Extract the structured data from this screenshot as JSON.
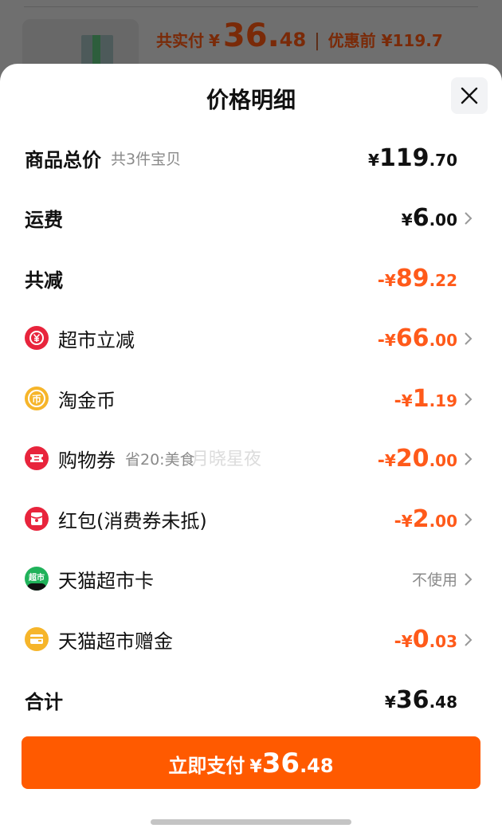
{
  "background": {
    "total_label": "共实付",
    "total_currency": "¥",
    "total_int": "36.",
    "total_dec": "48",
    "separator": "|",
    "before_label": "优惠前 ¥119.7"
  },
  "sheet": {
    "title": "价格明细",
    "close_icon": "close-icon"
  },
  "rows": {
    "goods": {
      "label": "商品总价",
      "sub": "共3件宝贝",
      "currency": "¥",
      "int": "119",
      "dec": ".70"
    },
    "shipping": {
      "label": "运费",
      "currency": "¥",
      "int": "6",
      "dec": ".00"
    },
    "discount_total": {
      "label": "共减",
      "sign": "-",
      "currency": "¥",
      "int": "89",
      "dec": ".22"
    },
    "supermarket_cut": {
      "label": "超市立减",
      "sign": "-",
      "currency": "¥",
      "int": "66",
      "dec": ".00",
      "icon": "yuan-coin-icon"
    },
    "taojin_coin": {
      "label": "淘金币",
      "sign": "-",
      "currency": "¥",
      "int": "1",
      "dec": ".19",
      "icon": "coin-icon",
      "icon_glyph": "币"
    },
    "shopping_voucher": {
      "label": "购物券",
      "sub": "省20:美食",
      "sign": "-",
      "currency": "¥",
      "int": "20",
      "dec": ".00",
      "icon": "ticket-icon"
    },
    "red_packet": {
      "label": "红包(消费券未抵)",
      "sign": "-",
      "currency": "¥",
      "int": "2",
      "dec": ".00",
      "icon": "red-packet-icon"
    },
    "tmall_card": {
      "label": "天猫超市卡",
      "value": "不使用",
      "icon": "tmall-card-icon",
      "icon_glyph": "超市"
    },
    "tmall_gift": {
      "label": "天猫超市赠金",
      "sign": "-",
      "currency": "¥",
      "int": "0",
      "dec": ".03",
      "icon": "wallet-icon"
    },
    "sum": {
      "label": "合计",
      "currency": "¥",
      "int": "36",
      "dec": ".48"
    }
  },
  "watermark": "月晓星夜",
  "pay_button": {
    "label": "立即支付",
    "currency": "¥",
    "int": "36",
    "dec": ".48"
  },
  "colors": {
    "accent": "#ff5a00",
    "discount": "#ff5a1a",
    "muted": "#8a8a8a"
  }
}
